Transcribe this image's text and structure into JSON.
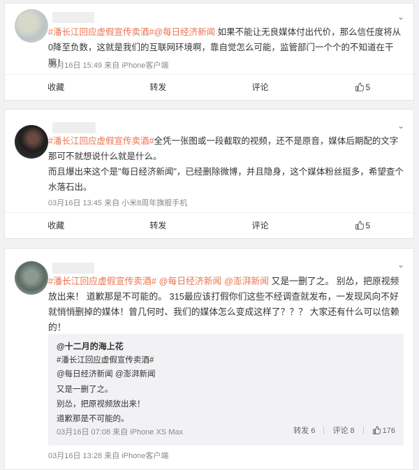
{
  "post1": {
    "topic": "#潘长江回应虚假宣传卖酒#",
    "mention": "@每日经济新闻",
    "text": " 如果不能让无良媒体付出代价，那么信任度将从0降至负数，这就是我们的互联网环境啊，靠自觉怎么可能，监管部门一个个的不知道在干嘛！",
    "meta": "03月16日 15:49  来自 iPhone客户端",
    "actions": {
      "fav": "收藏",
      "repost": "转发",
      "comment": "评论",
      "likes": "5"
    }
  },
  "post2": {
    "topic": "#潘长江回应虚假宣传卖酒#",
    "text1": "全凭一张图或一段截取的视频，还不是原音，媒体后期配的文字那可不就想说什么就是什么。",
    "text2": "而且爆出来这个是\"每日经济新闻\"，已经删除微博，并且隐身，这个媒体粉丝挺多，希望查个水落石出。",
    "meta": "03月16日 13:45  来自 小米8周年旗舰手机",
    "actions": {
      "fav": "收藏",
      "repost": "转发",
      "comment": "评论",
      "likes": "5"
    }
  },
  "post3": {
    "topic": "#潘长江回应虚假宣传卖酒#",
    "mention1": "@每日经济新闻",
    "mention2": "@澎湃新闻",
    "text": " 又是一删了之。 别怂，把原视频放出来！ 道歉那是不可能的。 315最应该打假你们这些不经调查就发布，一发现风向不好就悄悄删掉的媒体！曾几何时、我们的媒体怎么变成这样了？？？ 大家还有什么可以信赖的！",
    "meta": "03月16日 13:28  来自 iPhone客户端",
    "repost": {
      "author": "@十二月的海上花",
      "topic": "#潘长江回应虚假宣传卖酒#",
      "mentions": "@每日经济新闻 @澎湃新闻",
      "line1": "又是一删了之。",
      "line2": "别怂，把原视频放出来！",
      "line3": "道歉那是不可能的。",
      "meta": "03月16日 07:08  来自 iPhone XS Max",
      "reposts": "转发 6",
      "comments": "评论 8",
      "likes": "176"
    }
  }
}
